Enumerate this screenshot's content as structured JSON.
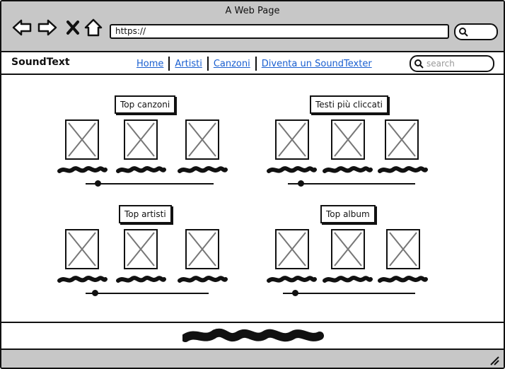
{
  "browser": {
    "window_title": "A Web Page",
    "url": "https://",
    "icons": [
      "back-arrow-icon",
      "forward-arrow-icon",
      "close-x-icon",
      "home-icon",
      "search-icon"
    ]
  },
  "site": {
    "logo": "SoundText",
    "nav": [
      {
        "label": "Home"
      },
      {
        "label": "Artisti"
      },
      {
        "label": "Canzoni"
      },
      {
        "label": "Diventa un SoundTexter"
      }
    ],
    "search_placeholder": "search"
  },
  "sections": [
    {
      "title": "Top canzoni",
      "items": 3,
      "slider_value": 0.07
    },
    {
      "title": "Testi più cliccati",
      "items": 3,
      "slider_value": 0.08
    },
    {
      "title": "Top artisti",
      "items": 3,
      "slider_value": 0.05
    },
    {
      "title": "Top album",
      "items": 3,
      "slider_value": 0.07
    }
  ],
  "colors": {
    "chrome": "#c7c7c7",
    "link": "#1a5fd0",
    "ink": "#111111"
  }
}
